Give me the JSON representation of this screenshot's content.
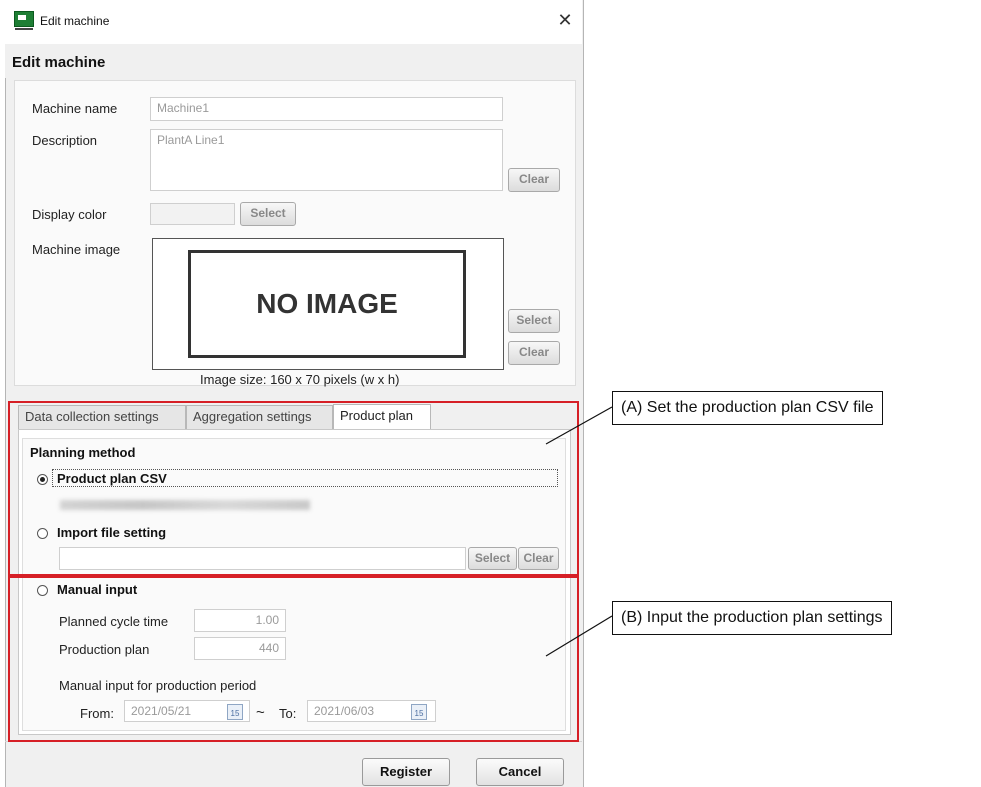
{
  "window": {
    "title": "Edit machine",
    "header": "Edit machine",
    "close_glyph": "✕"
  },
  "form": {
    "machine_name_label": "Machine name",
    "machine_name_value": "Machine1",
    "description_label": "Description",
    "description_value": "PlantA Line1",
    "description_clear": "Clear",
    "display_color_label": "Display color",
    "display_color_select": "Select",
    "machine_image_label": "Machine image",
    "no_image_text": "NO IMAGE",
    "image_select": "Select",
    "image_clear": "Clear",
    "image_size_text": "Image size: 160 x 70 pixels (w x h)"
  },
  "tabs": [
    {
      "label": "Data collection settings"
    },
    {
      "label": "Aggregation settings"
    },
    {
      "label": "Product plan"
    }
  ],
  "plan": {
    "planning_method": "Planning method",
    "product_plan_csv": "Product plan CSV",
    "import_file_setting": "Import file setting",
    "import_select": "Select",
    "import_clear": "Clear",
    "manual_input": "Manual input",
    "planned_cycle_time_label": "Planned cycle time",
    "planned_cycle_time_value": "1.00",
    "production_plan_label": "Production plan",
    "production_plan_value": "440",
    "manual_period_label": "Manual input for production period",
    "from_label": "From:",
    "from_value": "2021/05/21",
    "tilde": "~",
    "to_label": "To:",
    "to_value": "2021/06/03",
    "calendar_glyph": "15"
  },
  "footer": {
    "register": "Register",
    "cancel": "Cancel"
  },
  "callouts": {
    "a": "(A) Set the production plan CSV file",
    "b": "(B) Input the production plan settings"
  },
  "colors": {
    "highlight_red": "#d61f26",
    "app_icon_green": "#1e7e34"
  }
}
